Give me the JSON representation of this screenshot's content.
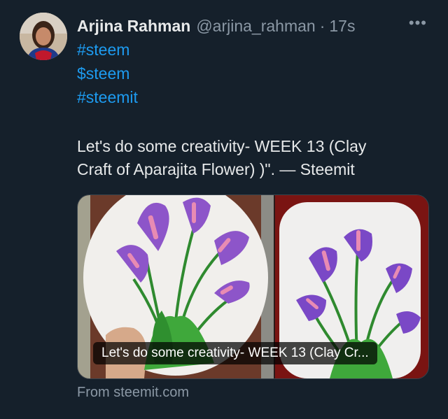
{
  "tweet": {
    "author_name": "Arjina Rahman",
    "handle": "@arjina_rahman",
    "separator": "·",
    "time": "17s",
    "more_label": "•••",
    "hashtags": [
      "#steem",
      "$steem",
      "#steemit"
    ],
    "body_line1": "Let's do some creativity- WEEK 13 (Clay",
    "body_line2": "Craft of Aparajita Flower) )\". — Steemit"
  },
  "link_card": {
    "title": "Let's do some creativity- WEEK 13 (Clay Cr...",
    "source": "From steemit.com"
  },
  "colors": {
    "background": "#15202b",
    "link": "#1d9bf0",
    "muted": "#8b98a5",
    "text": "#e7e9ea"
  }
}
